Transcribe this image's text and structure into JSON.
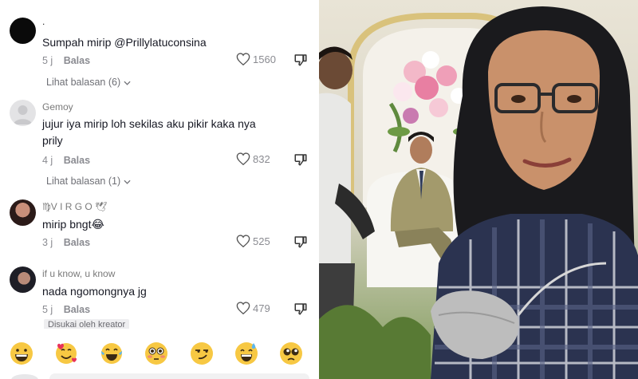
{
  "comments": [
    {
      "username": ".",
      "text": "Sumpah mirip @Prillylatuconsina",
      "time": "5 j",
      "reply_label": "Balas",
      "likes": "1560",
      "view_replies": "Lihat balasan (6)"
    },
    {
      "username": "Gemoy",
      "text": "jujur iya mirip loh sekilas aku pikir kaka nya prily",
      "time": "4 j",
      "reply_label": "Balas",
      "likes": "832",
      "view_replies": "Lihat balasan (1)"
    },
    {
      "username": "♍V I R G O 🕊",
      "text": "mirip bngt😂",
      "time": "3 j",
      "reply_label": "Balas",
      "likes": "525"
    },
    {
      "username": "if u know, u know",
      "text": "nada ngomongnya jg",
      "time": "5 j",
      "reply_label": "Balas",
      "likes": "479",
      "badge": "Disukai oleh kreator"
    }
  ],
  "emoji_bar": [
    "grinning-face",
    "smiling-face-with-hearts",
    "face-with-tears-of-joy",
    "flushed-face",
    "smirking-face",
    "grinning-face-with-sweat",
    "pleading-face"
  ],
  "colors": {
    "text": "#161823",
    "muted": "#8a8b91",
    "emoji_yellow": "#f7c843"
  }
}
